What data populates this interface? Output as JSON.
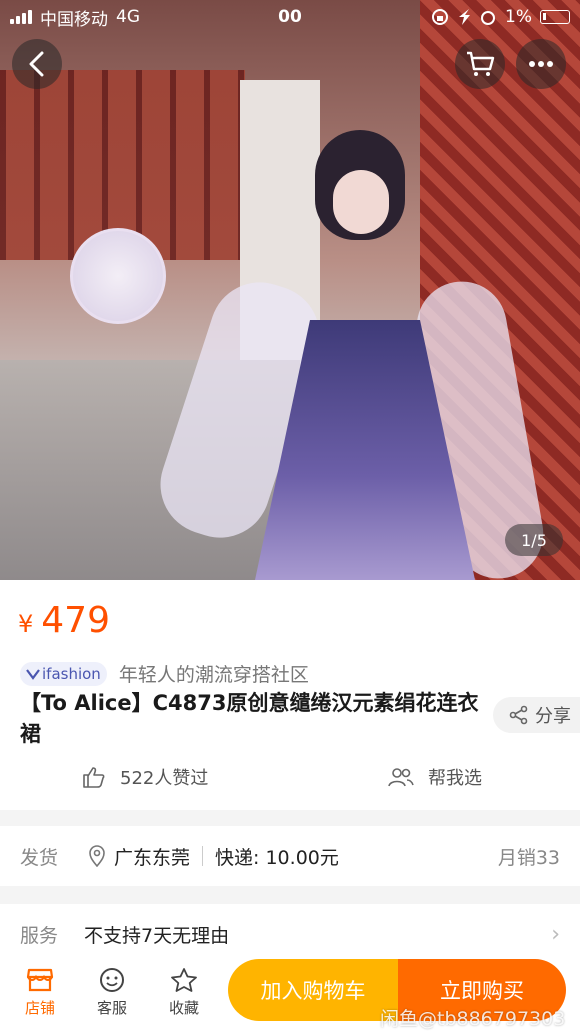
{
  "status_bar": {
    "carrier": "中国移动",
    "network": "4G",
    "time": "00",
    "battery": "1%"
  },
  "gallery": {
    "indicator": "1/5"
  },
  "price": {
    "symbol": "¥",
    "value": "479"
  },
  "brand": {
    "badge": "ifashion",
    "slogan": "年轻人的潮流穿搭社区"
  },
  "product": {
    "title": "【To Alice】C4873原创意缱绻汉元素绢花连衣裙"
  },
  "share_label": "分享",
  "likes": {
    "text": "522人赞过"
  },
  "help_choose": "帮我选",
  "shipping": {
    "label": "发货",
    "location": "广东东莞",
    "fee": "快递: 10.00元",
    "sales": "月销33"
  },
  "service": {
    "label": "服务",
    "value": "不支持7天无理由"
  },
  "bottom_bar": {
    "store": "店铺",
    "support": "客服",
    "favorite": "收藏",
    "add_to_cart": "加入购物车",
    "buy_now": "立即购买"
  },
  "watermark": "闲鱼@tb886797303"
}
